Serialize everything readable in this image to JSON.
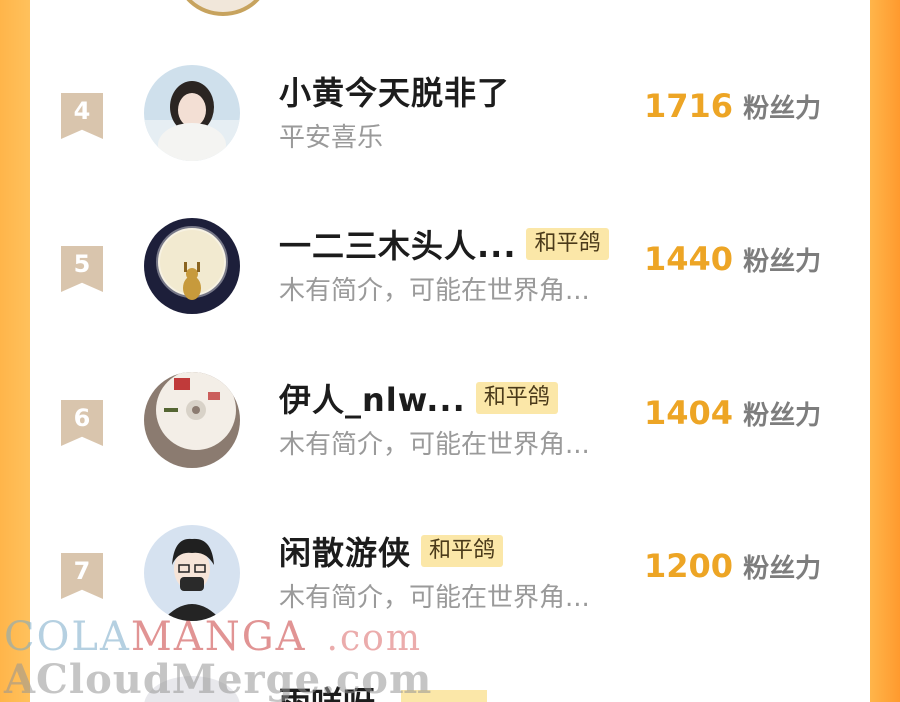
{
  "leaderboard": {
    "score_unit": "粉丝力",
    "rows": [
      {
        "rank": "4",
        "name": "小黄今天脱非了",
        "tag": "",
        "bio": "平安喜乐",
        "score": "1716"
      },
      {
        "rank": "5",
        "name": "一二三木头人...",
        "tag": "和平鸽",
        "bio": "木有简介，可能在世界角...",
        "score": "1440"
      },
      {
        "rank": "6",
        "name": "伊人_nlw...",
        "tag": "和平鸽",
        "bio": "木有简介，可能在世界角...",
        "score": "1404"
      },
      {
        "rank": "7",
        "name": "闲散游侠",
        "tag": "和平鸽",
        "bio": "木有简介，可能在世界角...",
        "score": "1200"
      }
    ],
    "next_row_name_partial": "雨咩呀"
  },
  "watermark": {
    "line1_a": "COLA",
    "line1_b": "MANGA",
    "line1_c": ".com",
    "line2": "ACloudMerge.com"
  }
}
